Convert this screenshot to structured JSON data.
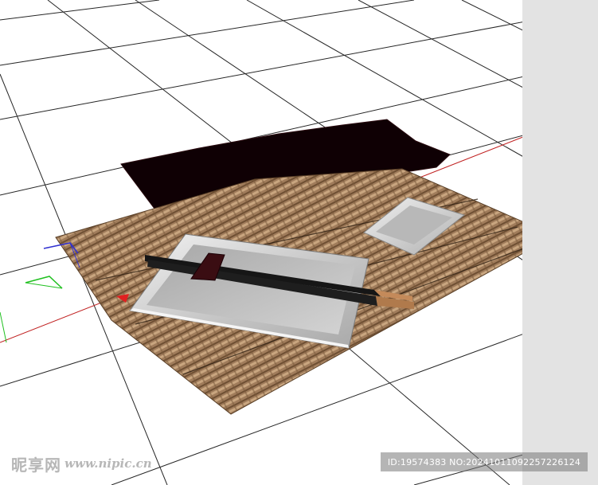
{
  "scene": {
    "description_colors": {
      "background": "#ffffff",
      "grid_lines": "#222222",
      "right_panel": "#e3e3e3",
      "dark_tray": "#100004",
      "bamboo_mat": "#9a7656",
      "plate": "#d8d8d8",
      "chopsticks": "#1b1b1b",
      "chopstick_rest": "#3a0d12",
      "axis_x": "#d42020",
      "axis_y": "#20c020",
      "axis_z": "#3030d0"
    },
    "objects": [
      "grid-floor",
      "dark-serving-tray",
      "bamboo-placemat",
      "small-sauce-dish",
      "rectangular-plate",
      "chopsticks",
      "chopstick-rest",
      "axis-gizmo"
    ]
  },
  "watermark": {
    "site_name": "昵享网",
    "site_url": "www.nipic.cn",
    "id_text": "ID:19574383 NO:20241011092257226124"
  }
}
